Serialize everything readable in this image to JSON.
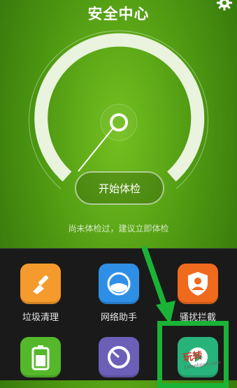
{
  "header": {
    "title": "安全中心"
  },
  "gauge": {
    "button_label": "开始体检",
    "hint": "尚未体检过，建议立即体检"
  },
  "tiles": [
    {
      "label": "垃圾清理",
      "icon": "broom-icon",
      "color": "#f59a2c"
    },
    {
      "label": "网络助手",
      "icon": "network-icon",
      "color": "#2f8fe6"
    },
    {
      "label": "骚扰拦截",
      "icon": "shield-person-icon",
      "color": "#f06a1e"
    },
    {
      "label": "",
      "icon": "battery-icon",
      "color": "#55b82a"
    },
    {
      "label": "",
      "icon": "speed-ring-icon",
      "color": "#6b5fb8"
    },
    {
      "label": "",
      "icon": "play-icon",
      "color": "#28b37a"
    }
  ],
  "annotation": {
    "watermark": "玩转",
    "watermark_sub": "Lisanligan.com"
  }
}
